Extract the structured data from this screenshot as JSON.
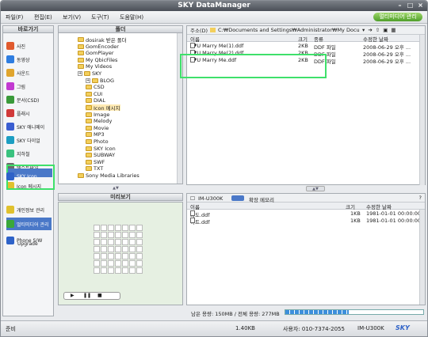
{
  "window": {
    "title": "SKY DataManager"
  },
  "menu": {
    "items": [
      "파일(F)",
      "편집(E)",
      "보기(V)",
      "도구(T)",
      "도움말(H)"
    ],
    "mm_button": "멀티미디어 관리"
  },
  "sidebar": {
    "header": "바로가기",
    "items": [
      {
        "label": "사진",
        "icon": "photo-icon",
        "color": "#e05a2e"
      },
      {
        "label": "동영상",
        "icon": "video-icon",
        "color": "#2e7de0"
      },
      {
        "label": "사운드",
        "icon": "sound-icon",
        "color": "#e0a52e"
      },
      {
        "label": "그림",
        "icon": "picture-icon",
        "color": "#c23ad1"
      },
      {
        "label": "문서(CSD)",
        "icon": "document-icon",
        "color": "#3a9a3a"
      },
      {
        "label": "플래시",
        "icon": "flash-icon",
        "color": "#d13a3a"
      },
      {
        "label": "SKY 애니메이",
        "icon": "animation-icon",
        "color": "#3a5ed1"
      },
      {
        "label": "SKY 다이얼",
        "icon": "dial-icon",
        "color": "#1c9ec2"
      },
      {
        "label": "지하철",
        "icon": "subway-icon",
        "color": "#3ac27f"
      },
      {
        "label": "텍스트파일",
        "icon": "textfile-icon",
        "color": "#6a6a6a"
      },
      {
        "label": "SKY Icon",
        "icon": "sky-icon",
        "color": "#2e62c8"
      },
      {
        "label": "Icon 메시지",
        "icon": "icon-message-icon",
        "color": "#e0c12e"
      }
    ],
    "bottom": [
      {
        "label": "개인정보 관리",
        "icon": "personal-icon",
        "color": "#e0c12e"
      },
      {
        "label": "멀티미디어 관리",
        "icon": "multimedia-icon",
        "color": "#3aa83a"
      },
      {
        "label": "Phone S/W",
        "label2": "Upgrade",
        "icon": "upgrade-icon",
        "color": "#2e62c8"
      }
    ]
  },
  "folders": {
    "header": "폴더",
    "items": [
      "dosirak 받은 폴더",
      "GomEncoder",
      "GomPlayer",
      "My QbicFiles",
      "My Videos",
      "SKY",
      "BLOG",
      "CSD",
      "CUI",
      "DIAL",
      "Icon 메시지",
      "Image",
      "Melody",
      "Movie",
      "MP3",
      "Photo",
      "SKY Icon",
      "SUBWAY",
      "SWF",
      "TXT",
      "Sony Media Libraries"
    ]
  },
  "preview": {
    "header": "미리보기"
  },
  "upper": {
    "address_label": "주소(D)",
    "address": "C:₩Documents and Settings₩Administrator₩My Docu",
    "columns": [
      "이름",
      "크기",
      "종류",
      "수정한 날짜"
    ],
    "rows": [
      {
        "name": "[♥U Marry Me(1).ddf",
        "size": "2KB",
        "type": "DDF 파일",
        "date": "2008-06-29 오후 ..."
      },
      {
        "name": "[♥U Marry Me(2).ddf",
        "size": "2KB",
        "type": "DDF 파일",
        "date": "2008-06-29 오후 ..."
      },
      {
        "name": "[♥U Marry Me.ddf",
        "size": "2KB",
        "type": "DDF 파일",
        "date": "2008-06-29 오후 ..."
      }
    ]
  },
  "lower": {
    "device": "IM-U300K",
    "memory": "확장 메모리",
    "columns": [
      "이름",
      "크기",
      "수정한 날짜"
    ],
    "rows": [
      {
        "name": "파도.ddf",
        "size": "1KB",
        "date": "1981-01-01 00:00:00"
      },
      {
        "name": "하트.ddf",
        "size": "1KB",
        "date": "1981-01-01 00:00:00"
      }
    ]
  },
  "usage": {
    "text": "남은 용량: 150MB / 전체 용량: 277MB",
    "used_fraction": 0.46
  },
  "status": {
    "left": "준비",
    "size": "1.40KB",
    "user": "사용자: 010-7374-2055",
    "model": "IM-U300K",
    "brand": "SKY"
  }
}
